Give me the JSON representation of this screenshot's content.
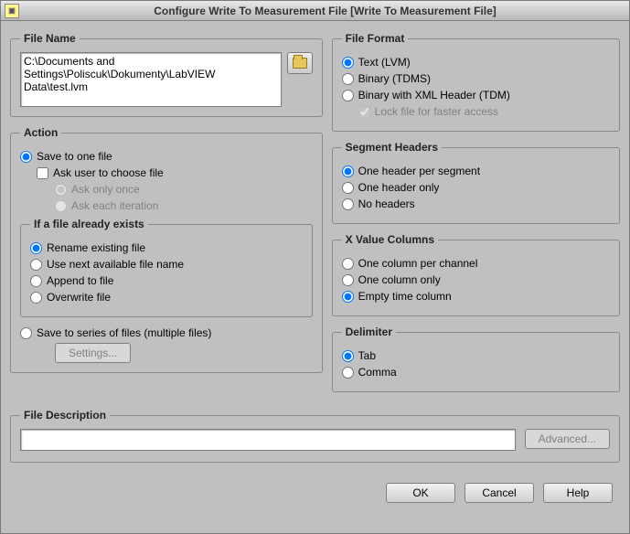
{
  "window": {
    "title": "Configure Write To Measurement File [Write To Measurement File]"
  },
  "fileName": {
    "legend": "File Name",
    "path": "C:\\Documents and Settings\\Poliscuk\\Dokumenty\\LabVIEW Data\\test.lvm"
  },
  "action": {
    "legend": "Action",
    "saveToOne": "Save to one file",
    "askUser": "Ask user to choose file",
    "askOnlyOnce": "Ask only once",
    "askEachIter": "Ask each iteration",
    "ifExistsLegend": "If a file already exists",
    "renameExisting": "Rename existing file",
    "useNextAvail": "Use next available file name",
    "appendToFile": "Append to file",
    "overwriteFile": "Overwrite file",
    "saveToSeries": "Save to series of files (multiple files)",
    "settingsBtn": "Settings..."
  },
  "fileFormat": {
    "legend": "File Format",
    "textLvm": "Text (LVM)",
    "binaryTdms": "Binary (TDMS)",
    "binaryXmlTdm": "Binary with XML Header (TDM)",
    "lockFile": "Lock file for faster access"
  },
  "segmentHeaders": {
    "legend": "Segment Headers",
    "onePerSegment": "One header per segment",
    "oneOnly": "One header only",
    "noHeaders": "No headers"
  },
  "xValueColumns": {
    "legend": "X Value Columns",
    "onePerChannel": "One column per channel",
    "oneOnly": "One column only",
    "emptyTime": "Empty time column"
  },
  "delimiter": {
    "legend": "Delimiter",
    "tab": "Tab",
    "comma": "Comma"
  },
  "fileDescription": {
    "legend": "File Description",
    "value": "",
    "advancedBtn": "Advanced..."
  },
  "footer": {
    "ok": "OK",
    "cancel": "Cancel",
    "help": "Help"
  }
}
